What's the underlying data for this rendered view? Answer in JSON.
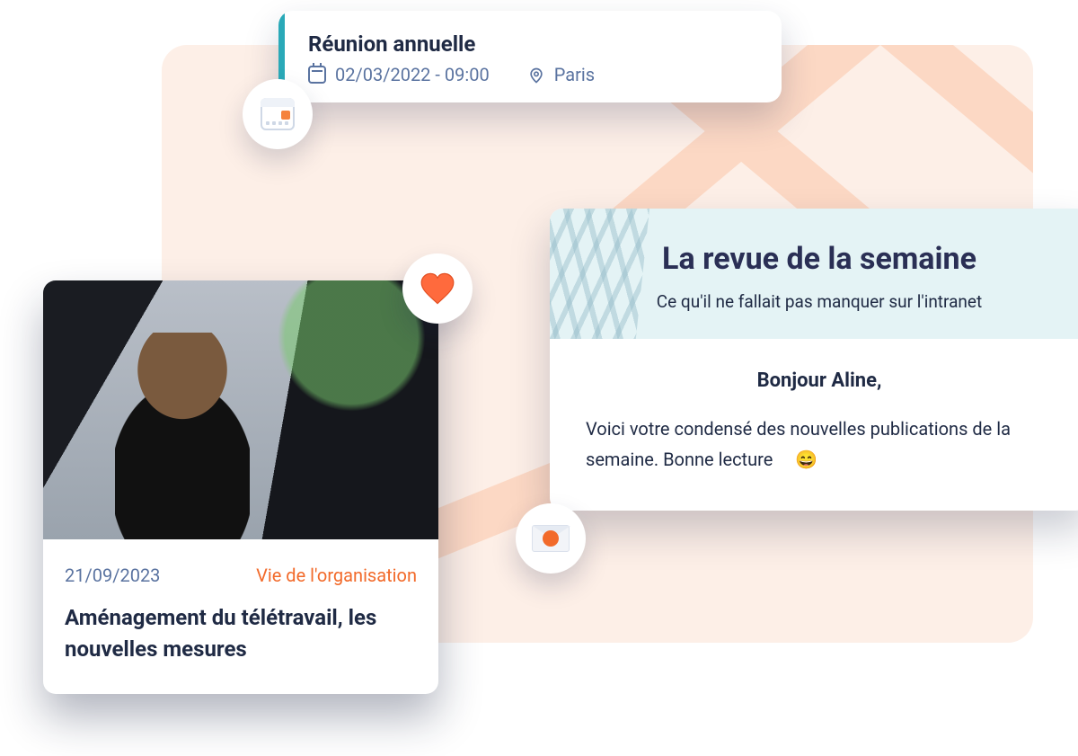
{
  "event": {
    "title": "Réunion annuelle",
    "datetime": "02/03/2022 - 09:00",
    "location": "Paris"
  },
  "article": {
    "date": "21/09/2023",
    "category": "Vie de l'organisation",
    "title": "Aménagement du télétravail, les nouvelles mesures"
  },
  "newsletter": {
    "title": "La revue de la semaine",
    "subtitle": "Ce qu'il ne fallait pas manquer sur l'intranet",
    "greeting": "Bonjour Aline,",
    "body": "Voici votre condensé des nouvelles publications de la semaine. Bonne lecture",
    "emoji": "😄"
  },
  "colors": {
    "accent_orange": "#f26a2a",
    "accent_teal": "#2aa9b8",
    "text_primary": "#1f2a44",
    "text_muted": "#5a73a0",
    "bg_peach": "#fdefe7"
  }
}
